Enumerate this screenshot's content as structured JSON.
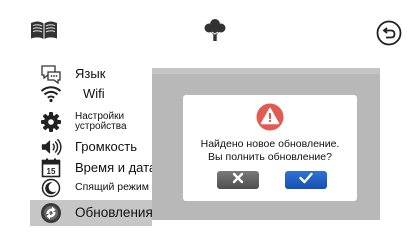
{
  "topbar": {
    "left_icon": "book-icon",
    "center_icon": "tree-icon",
    "right_icon": "back-icon"
  },
  "sidebar": {
    "items": [
      {
        "label": "Язык",
        "icon": "language-chat-icon"
      },
      {
        "label": "Wifi",
        "icon": "wifi-icon"
      },
      {
        "label": "Настройки\nустройства",
        "icon": "gear-icon"
      },
      {
        "label": "Громкость",
        "icon": "speaker-icon"
      },
      {
        "label": "Время и дата",
        "icon": "calendar-icon"
      },
      {
        "label": "Спящий режим",
        "icon": "moon-icon"
      },
      {
        "label": "Обновления",
        "icon": "update-icon",
        "selected": true
      }
    ]
  },
  "dialog": {
    "icon": "warning-icon",
    "message_line1": "Найдено новое обновление.",
    "message_line2": "Вы полнить обновление?",
    "cancel_icon": "close-icon",
    "confirm_icon": "check-icon"
  },
  "colors": {
    "panel": "#b8b8b8",
    "selected_item": "#c6c6c6",
    "warning": "#e25a52",
    "confirm": "#1e5fc4",
    "cancel": "#5c5c5c"
  }
}
